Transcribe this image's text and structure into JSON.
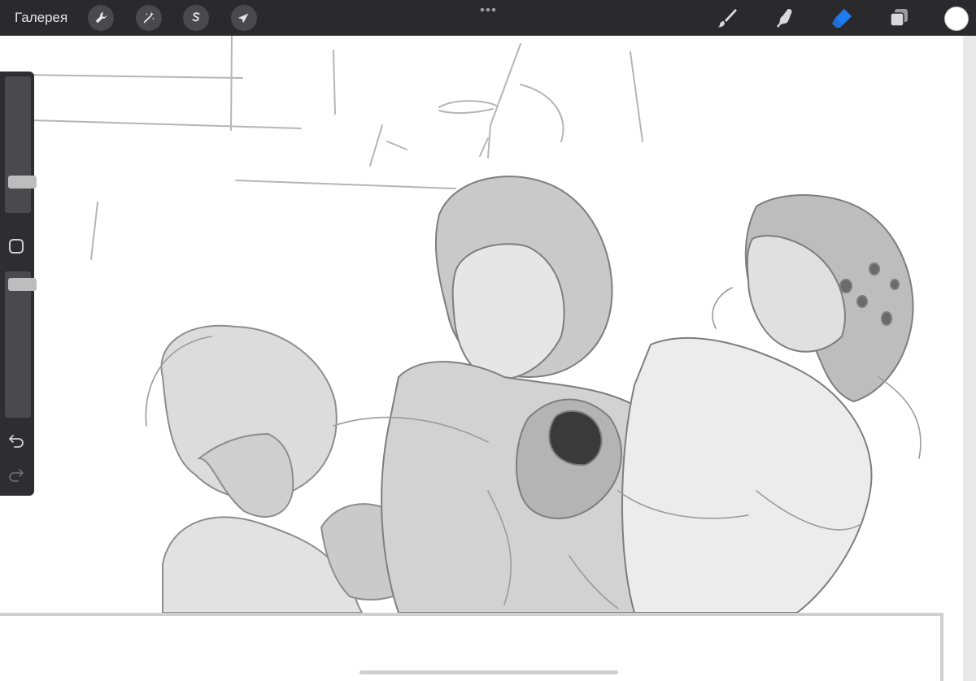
{
  "toolbar": {
    "gallery_label": "Галерея",
    "left_tools": [
      {
        "name": "actions",
        "icon": "wrench-icon"
      },
      {
        "name": "adjustments",
        "icon": "magic-wand-icon"
      },
      {
        "name": "selection",
        "icon": "selection-s-icon"
      },
      {
        "name": "transform",
        "icon": "arrow-cursor-icon"
      }
    ],
    "more_icon": "ellipsis-icon",
    "right_tools": [
      {
        "name": "brush",
        "icon": "brush-icon",
        "active": false
      },
      {
        "name": "smudge",
        "icon": "smudge-finger-icon",
        "active": false
      },
      {
        "name": "eraser",
        "icon": "eraser-icon",
        "active": true
      },
      {
        "name": "layers",
        "icon": "layers-icon",
        "active": false
      }
    ],
    "current_color": "#ffffff"
  },
  "sidebar": {
    "brush_size": 0.2,
    "brush_opacity": 0.95,
    "modify_icon": "square-icon",
    "undo_icon": "undo-icon",
    "redo_icon": "redo-icon",
    "redo_enabled": false
  },
  "colors": {
    "toolbar_bg": "#2a2a2c",
    "active_tool": "#1e7cf2",
    "canvas_bg": "#ffffff"
  }
}
